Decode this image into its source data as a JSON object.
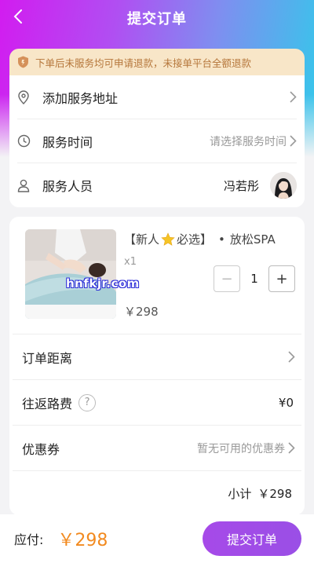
{
  "header": {
    "title": "提交订单"
  },
  "notice": {
    "text": "下单后未服务均可申请退款，未接单平台全额退款"
  },
  "info": {
    "address_label": "添加服务地址",
    "time_label": "服务时间",
    "time_placeholder": "请选择服务时间",
    "staff_label": "服务人员",
    "staff_name": "冯若彤"
  },
  "product": {
    "name_prefix": "【新人",
    "name_suffix": "必选】",
    "name_dot": "•",
    "name_service": "放松SPA",
    "qty_tag": "x1",
    "price": "￥298",
    "quantity": "1",
    "minus": "−",
    "plus": "+",
    "watermark": "hnfkjr.com"
  },
  "order_rows": {
    "distance_label": "订单距离",
    "travel_label": "往返路费",
    "travel_help": "?",
    "travel_value": "¥0",
    "coupon_label": "优惠券",
    "coupon_value": "暂无可用的优惠券",
    "subtotal_label": "小计",
    "subtotal_value": "￥298"
  },
  "footer": {
    "pay_label": "应付:",
    "pay_amount": "￥298",
    "submit_label": "提交订单"
  },
  "colors": {
    "accent": "#a64ae8",
    "price": "#f28a1f",
    "notice_bg": "#f8e6c8",
    "notice_text": "#b5763a"
  },
  "icons": [
    "back-icon",
    "shield-icon",
    "location-icon",
    "clock-icon",
    "person-icon",
    "chevron-right-icon",
    "star-icon",
    "help-icon"
  ]
}
